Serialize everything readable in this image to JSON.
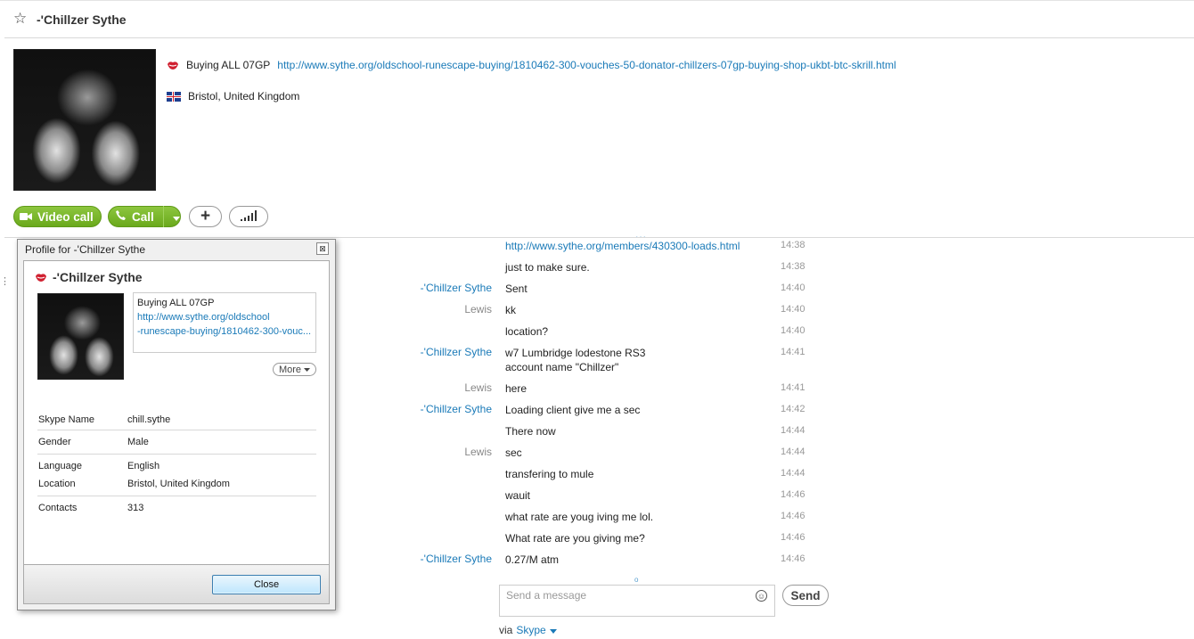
{
  "header": {
    "contact_name": "-'Chillzer Sythe",
    "mood_text": "Buying ALL 07GP",
    "mood_link": "http://www.sythe.org/oldschool-runescape-buying/1810462-300-vouches-50-donator-chillzers-07gp-buying-shop-ukbt-btc-skrill.html",
    "location": "Bristol, United Kingdom"
  },
  "actions": {
    "video_call": "Video call",
    "call": "Call",
    "add": "+"
  },
  "chat": {
    "messages": [
      {
        "sender": "",
        "sender_type": "none",
        "text": "http://www.sythe.org/members/430300-loads.html",
        "is_link": true,
        "time": "14:38"
      },
      {
        "sender": "",
        "sender_type": "none",
        "text": "just to make sure.",
        "time": "14:38"
      },
      {
        "sender": "-'Chillzer Sythe",
        "sender_type": "them",
        "text": "Sent",
        "time": "14:40"
      },
      {
        "sender": "Lewis",
        "sender_type": "me",
        "text": "kk",
        "time": "14:40"
      },
      {
        "sender": "",
        "sender_type": "none",
        "text": "location?",
        "time": "14:40"
      },
      {
        "sender": "-'Chillzer Sythe",
        "sender_type": "them",
        "text": "w7 Lumbridge lodestone RS3",
        "text2": "account name \"Chillzer\"",
        "time": "14:41"
      },
      {
        "sender": "Lewis",
        "sender_type": "me",
        "text": "here",
        "time": "14:41"
      },
      {
        "sender": "-'Chillzer Sythe",
        "sender_type": "them",
        "text": "Loading client give me a sec",
        "time": "14:42"
      },
      {
        "sender": "",
        "sender_type": "none",
        "text": "There now",
        "time": "14:44"
      },
      {
        "sender": "Lewis",
        "sender_type": "me",
        "text": "sec",
        "time": "14:44"
      },
      {
        "sender": "",
        "sender_type": "none",
        "text": "transfering to mule",
        "time": "14:44"
      },
      {
        "sender": "",
        "sender_type": "none",
        "text": "wauit",
        "time": "14:46"
      },
      {
        "sender": "",
        "sender_type": "none",
        "text": "what rate are youg iving me lol.",
        "time": "14:46"
      },
      {
        "sender": "",
        "sender_type": "none",
        "text": "What rate are you giving me?",
        "time": "14:46"
      },
      {
        "sender": "-'Chillzer Sythe",
        "sender_type": "them",
        "text": "0.27/M atm",
        "time": "14:46"
      }
    ],
    "more_indicator": "...",
    "input_placeholder": "Send a message",
    "send_label": "Send",
    "via_label": "via",
    "via_service": "Skype"
  },
  "profile_dialog": {
    "title": "Profile for -'Chillzer Sythe",
    "name": "-'Chillzer Sythe",
    "mood_line1": "Buying ALL 07GP",
    "mood_line2": "http://www.sythe.org/oldschool",
    "mood_line3": "-runescape-buying/1810462-300-vouc...",
    "more_label": "More",
    "fields": [
      {
        "label": "Skype Name",
        "value": "chill.sythe"
      },
      {
        "label": "Gender",
        "value": "Male"
      },
      {
        "label": "Language",
        "value": "English"
      },
      {
        "label": "Location",
        "value": "Bristol, United Kingdom"
      },
      {
        "label": "Contacts",
        "value": "313"
      }
    ],
    "close_label": "Close"
  },
  "colors": {
    "link": "#1a7ab8",
    "green": "#7ab82a",
    "mood_icon": "#d02030"
  },
  "icons": [
    "star-icon",
    "mood-lips-icon",
    "uk-flag-icon",
    "video-camera-icon",
    "phone-icon",
    "chevron-down-icon",
    "plus-icon",
    "signal-bars-icon",
    "emoji-icon",
    "close-icon"
  ]
}
